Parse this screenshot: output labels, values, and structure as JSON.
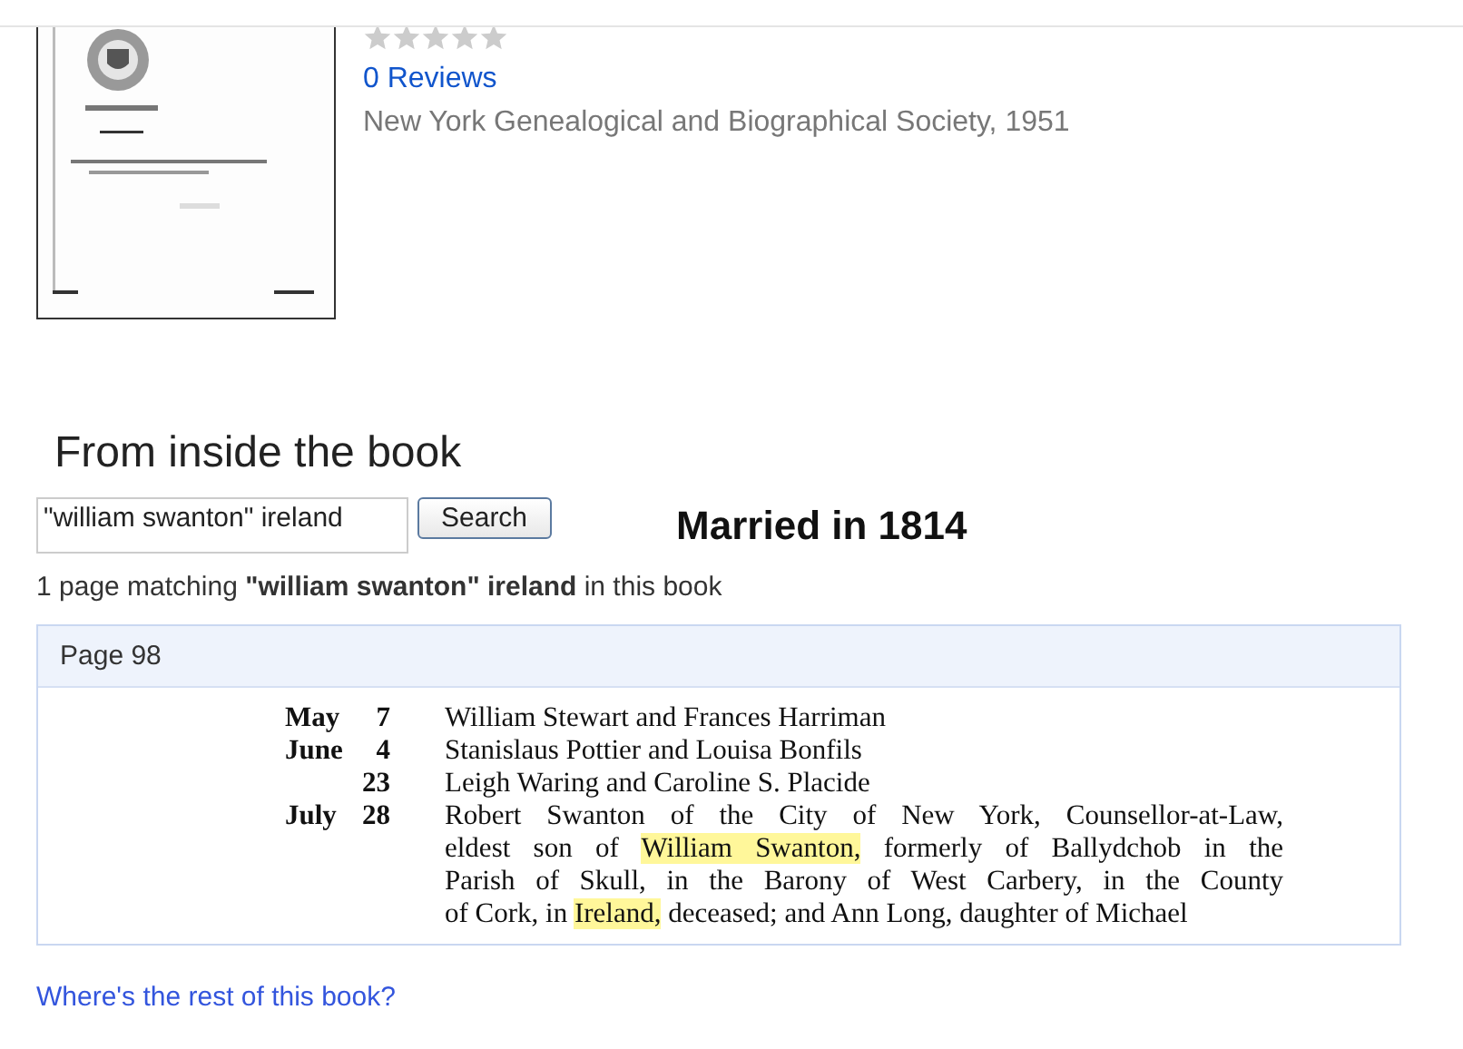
{
  "book": {
    "stars": 0,
    "reviews": "0 Reviews",
    "publisher": "New York Genealogical and Biographical Society, 1951"
  },
  "inside": {
    "heading": "From inside the book",
    "query": "\"william swanton\" ireland",
    "search_button": "Search",
    "note": "Married in 1814",
    "summary": "1 page matching **\"william swanton\" ireland** in this book",
    "result": {
      "page": "Page 98",
      "entries": [
        {
          "month": "May",
          "day": "7",
          "lines": [
            [
              {
                "text": "William Stewart and Frances Harriman",
                "highlight": false
              }
            ]
          ]
        },
        {
          "month": "June",
          "day": "4",
          "lines": [
            [
              {
                "text": "Stanislaus Pottier and Louisa Bonfils",
                "highlight": false
              }
            ]
          ]
        },
        {
          "day": "23",
          "lines": [
            [
              {
                "text": "Leigh Waring and Caroline S. Placide",
                "highlight": false
              }
            ]
          ]
        },
        {
          "month": "July",
          "day": "28",
          "lines": [
            [
              {
                "text": "Robert Swanton of the City of New York, Counsellor-at-Law,",
                "highlight": false
              }
            ],
            [
              {
                "text": "eldest son of ",
                "highlight": false
              },
              {
                "text": "William Swanton,",
                "highlight": true
              },
              {
                "text": " formerly of Ballydchob in the",
                "highlight": false
              }
            ],
            [
              {
                "text": "Parish of Skull, in the Barony of West Carbery, in the County",
                "highlight": false
              }
            ],
            [
              {
                "text": "of Cork, in ",
                "highlight": false
              },
              {
                "text": "Ireland,",
                "highlight": true
              },
              {
                "text": " deceased; and Ann Long, daughter of Michael",
                "highlight": false
              }
            ]
          ]
        }
      ]
    }
  },
  "rest_link": "Where's the rest of this book?"
}
